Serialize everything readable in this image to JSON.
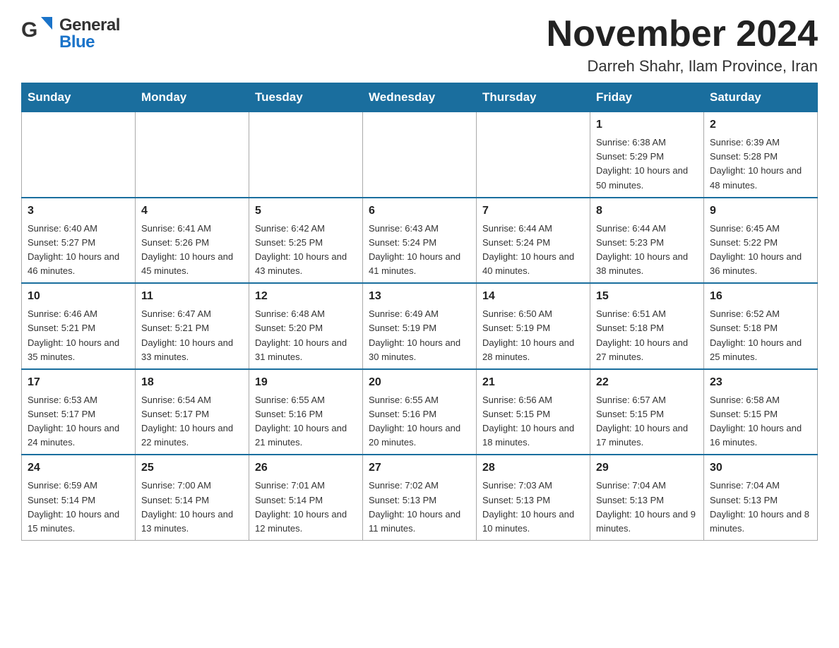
{
  "header": {
    "logo_general": "General",
    "logo_blue": "Blue",
    "month_title": "November 2024",
    "subtitle": "Darreh Shahr, Ilam Province, Iran"
  },
  "calendar": {
    "days_of_week": [
      "Sunday",
      "Monday",
      "Tuesday",
      "Wednesday",
      "Thursday",
      "Friday",
      "Saturday"
    ],
    "weeks": [
      [
        {
          "day": "",
          "info": ""
        },
        {
          "day": "",
          "info": ""
        },
        {
          "day": "",
          "info": ""
        },
        {
          "day": "",
          "info": ""
        },
        {
          "day": "",
          "info": ""
        },
        {
          "day": "1",
          "info": "Sunrise: 6:38 AM\nSunset: 5:29 PM\nDaylight: 10 hours and 50 minutes."
        },
        {
          "day": "2",
          "info": "Sunrise: 6:39 AM\nSunset: 5:28 PM\nDaylight: 10 hours and 48 minutes."
        }
      ],
      [
        {
          "day": "3",
          "info": "Sunrise: 6:40 AM\nSunset: 5:27 PM\nDaylight: 10 hours and 46 minutes."
        },
        {
          "day": "4",
          "info": "Sunrise: 6:41 AM\nSunset: 5:26 PM\nDaylight: 10 hours and 45 minutes."
        },
        {
          "day": "5",
          "info": "Sunrise: 6:42 AM\nSunset: 5:25 PM\nDaylight: 10 hours and 43 minutes."
        },
        {
          "day": "6",
          "info": "Sunrise: 6:43 AM\nSunset: 5:24 PM\nDaylight: 10 hours and 41 minutes."
        },
        {
          "day": "7",
          "info": "Sunrise: 6:44 AM\nSunset: 5:24 PM\nDaylight: 10 hours and 40 minutes."
        },
        {
          "day": "8",
          "info": "Sunrise: 6:44 AM\nSunset: 5:23 PM\nDaylight: 10 hours and 38 minutes."
        },
        {
          "day": "9",
          "info": "Sunrise: 6:45 AM\nSunset: 5:22 PM\nDaylight: 10 hours and 36 minutes."
        }
      ],
      [
        {
          "day": "10",
          "info": "Sunrise: 6:46 AM\nSunset: 5:21 PM\nDaylight: 10 hours and 35 minutes."
        },
        {
          "day": "11",
          "info": "Sunrise: 6:47 AM\nSunset: 5:21 PM\nDaylight: 10 hours and 33 minutes."
        },
        {
          "day": "12",
          "info": "Sunrise: 6:48 AM\nSunset: 5:20 PM\nDaylight: 10 hours and 31 minutes."
        },
        {
          "day": "13",
          "info": "Sunrise: 6:49 AM\nSunset: 5:19 PM\nDaylight: 10 hours and 30 minutes."
        },
        {
          "day": "14",
          "info": "Sunrise: 6:50 AM\nSunset: 5:19 PM\nDaylight: 10 hours and 28 minutes."
        },
        {
          "day": "15",
          "info": "Sunrise: 6:51 AM\nSunset: 5:18 PM\nDaylight: 10 hours and 27 minutes."
        },
        {
          "day": "16",
          "info": "Sunrise: 6:52 AM\nSunset: 5:18 PM\nDaylight: 10 hours and 25 minutes."
        }
      ],
      [
        {
          "day": "17",
          "info": "Sunrise: 6:53 AM\nSunset: 5:17 PM\nDaylight: 10 hours and 24 minutes."
        },
        {
          "day": "18",
          "info": "Sunrise: 6:54 AM\nSunset: 5:17 PM\nDaylight: 10 hours and 22 minutes."
        },
        {
          "day": "19",
          "info": "Sunrise: 6:55 AM\nSunset: 5:16 PM\nDaylight: 10 hours and 21 minutes."
        },
        {
          "day": "20",
          "info": "Sunrise: 6:55 AM\nSunset: 5:16 PM\nDaylight: 10 hours and 20 minutes."
        },
        {
          "day": "21",
          "info": "Sunrise: 6:56 AM\nSunset: 5:15 PM\nDaylight: 10 hours and 18 minutes."
        },
        {
          "day": "22",
          "info": "Sunrise: 6:57 AM\nSunset: 5:15 PM\nDaylight: 10 hours and 17 minutes."
        },
        {
          "day": "23",
          "info": "Sunrise: 6:58 AM\nSunset: 5:15 PM\nDaylight: 10 hours and 16 minutes."
        }
      ],
      [
        {
          "day": "24",
          "info": "Sunrise: 6:59 AM\nSunset: 5:14 PM\nDaylight: 10 hours and 15 minutes."
        },
        {
          "day": "25",
          "info": "Sunrise: 7:00 AM\nSunset: 5:14 PM\nDaylight: 10 hours and 13 minutes."
        },
        {
          "day": "26",
          "info": "Sunrise: 7:01 AM\nSunset: 5:14 PM\nDaylight: 10 hours and 12 minutes."
        },
        {
          "day": "27",
          "info": "Sunrise: 7:02 AM\nSunset: 5:13 PM\nDaylight: 10 hours and 11 minutes."
        },
        {
          "day": "28",
          "info": "Sunrise: 7:03 AM\nSunset: 5:13 PM\nDaylight: 10 hours and 10 minutes."
        },
        {
          "day": "29",
          "info": "Sunrise: 7:04 AM\nSunset: 5:13 PM\nDaylight: 10 hours and 9 minutes."
        },
        {
          "day": "30",
          "info": "Sunrise: 7:04 AM\nSunset: 5:13 PM\nDaylight: 10 hours and 8 minutes."
        }
      ]
    ]
  }
}
